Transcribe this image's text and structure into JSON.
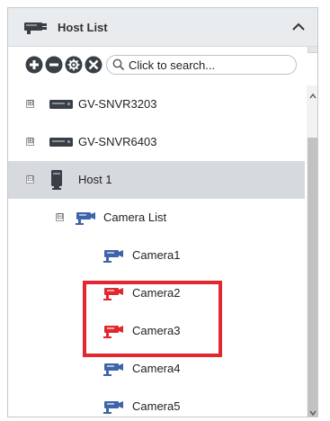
{
  "header": {
    "title": "Host List",
    "host_icon": "host-server-icon",
    "collapse_icon": "chevron-up-icon"
  },
  "toolbar": {
    "buttons": [
      "add-icon",
      "remove-icon",
      "settings-icon",
      "tools-icon"
    ],
    "search_placeholder": "Click to search..."
  },
  "tree": {
    "nvr1": {
      "label": "GV-SNVR3203",
      "expander": "⊞"
    },
    "nvr2": {
      "label": "GV-SNVR6403",
      "expander": "⊞"
    },
    "host1": {
      "label": "Host 1",
      "expander": "⊟"
    },
    "camera_list": {
      "label": "Camera List",
      "expander": "⊟"
    },
    "cameras": [
      {
        "label": "Camera1",
        "status": "normal"
      },
      {
        "label": "Camera2",
        "status": "alert"
      },
      {
        "label": "Camera3",
        "status": "alert"
      },
      {
        "label": "Camera4",
        "status": "normal"
      },
      {
        "label": "Camera5",
        "status": "normal"
      }
    ]
  },
  "colors": {
    "camera_normal": "#3f64a8",
    "camera_alert": "#e0282e",
    "highlight": "#e0282e",
    "selected_row": "#d6dadf",
    "header_bg": "#e9ecef"
  }
}
